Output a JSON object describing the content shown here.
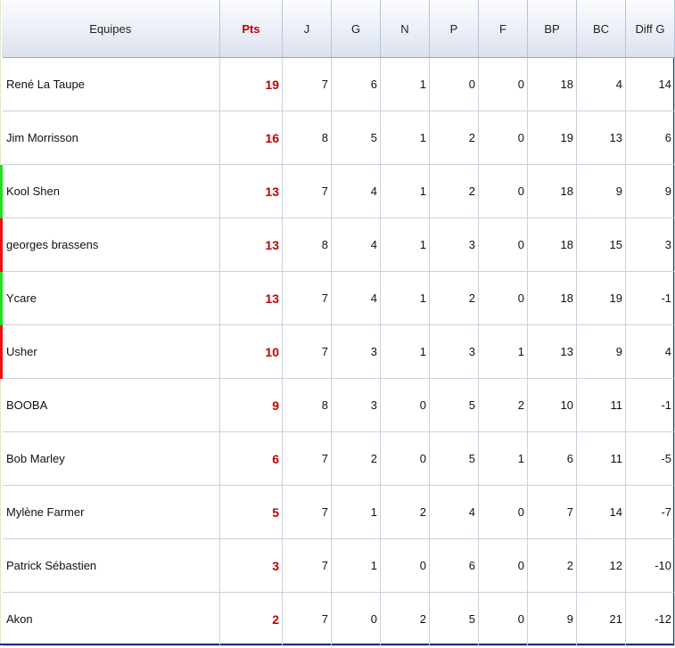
{
  "table": {
    "headers": [
      "Equipes",
      "Pts",
      "J",
      "G",
      "N",
      "P",
      "F",
      "BP",
      "BC",
      "Diff G"
    ],
    "rows": [
      {
        "team": "René La Taupe",
        "marker": "none",
        "pts": "19",
        "j": "7",
        "g": "6",
        "n": "1",
        "p": "0",
        "f": "0",
        "bp": "18",
        "bc": "4",
        "diff": "14"
      },
      {
        "team": "Jim Morrisson",
        "marker": "none",
        "pts": "16",
        "j": "8",
        "g": "5",
        "n": "1",
        "p": "2",
        "f": "0",
        "bp": "19",
        "bc": "13",
        "diff": "6"
      },
      {
        "team": "Kool Shen",
        "marker": "green",
        "pts": "13",
        "j": "7",
        "g": "4",
        "n": "1",
        "p": "2",
        "f": "0",
        "bp": "18",
        "bc": "9",
        "diff": "9"
      },
      {
        "team": "georges brassens",
        "marker": "red",
        "pts": "13",
        "j": "8",
        "g": "4",
        "n": "1",
        "p": "3",
        "f": "0",
        "bp": "18",
        "bc": "15",
        "diff": "3"
      },
      {
        "team": "Ycare",
        "marker": "green",
        "pts": "13",
        "j": "7",
        "g": "4",
        "n": "1",
        "p": "2",
        "f": "0",
        "bp": "18",
        "bc": "19",
        "diff": "-1"
      },
      {
        "team": "Usher",
        "marker": "red",
        "pts": "10",
        "j": "7",
        "g": "3",
        "n": "1",
        "p": "3",
        "f": "1",
        "bp": "13",
        "bc": "9",
        "diff": "4"
      },
      {
        "team": "BOOBA",
        "marker": "none",
        "pts": "9",
        "j": "8",
        "g": "3",
        "n": "0",
        "p": "5",
        "f": "2",
        "bp": "10",
        "bc": "11",
        "diff": "-1"
      },
      {
        "team": "Bob Marley",
        "marker": "none",
        "pts": "6",
        "j": "7",
        "g": "2",
        "n": "0",
        "p": "5",
        "f": "1",
        "bp": "6",
        "bc": "11",
        "diff": "-5"
      },
      {
        "team": "Mylène Farmer",
        "marker": "none",
        "pts": "5",
        "j": "7",
        "g": "1",
        "n": "2",
        "p": "4",
        "f": "0",
        "bp": "7",
        "bc": "14",
        "diff": "-7"
      },
      {
        "team": "Patrick Sébastien",
        "marker": "none",
        "pts": "3",
        "j": "7",
        "g": "1",
        "n": "0",
        "p": "6",
        "f": "0",
        "bp": "2",
        "bc": "12",
        "diff": "-10"
      },
      {
        "team": "Akon",
        "marker": "none",
        "pts": "2",
        "j": "7",
        "g": "0",
        "n": "2",
        "p": "5",
        "f": "0",
        "bp": "9",
        "bc": "21",
        "diff": "-12"
      }
    ]
  },
  "colors": {
    "points_text": "#c00000",
    "marker_green": "#22dd22",
    "marker_red": "#ee1111",
    "frame_border": "#1c2d8a"
  }
}
